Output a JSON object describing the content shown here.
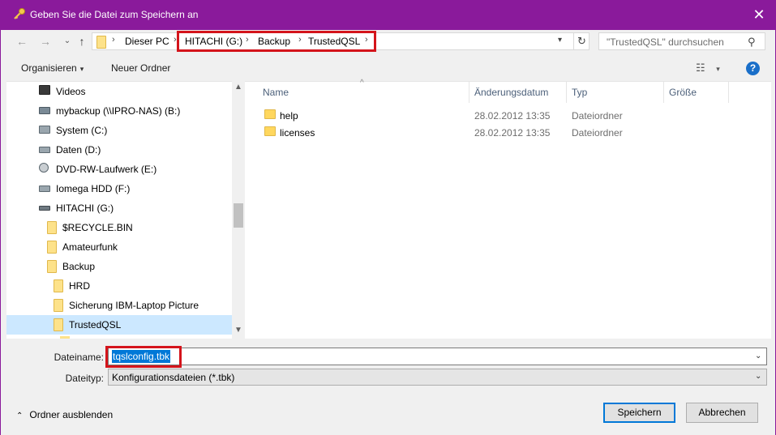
{
  "window": {
    "title": "Geben Sie die Datei zum Speichern an",
    "close_glyph": "✕"
  },
  "address": {
    "segments": [
      "Dieser PC",
      "HITACHI (G:)",
      "Backup",
      "TrustedQSL"
    ]
  },
  "search": {
    "placeholder": "\"TrustedQSL\" durchsuchen"
  },
  "toolbar": {
    "organize_label": "Organisieren",
    "new_folder_label": "Neuer Ordner",
    "help_label": "?"
  },
  "nav": {
    "items": [
      {
        "label": "Videos",
        "icon": "video-icon"
      },
      {
        "label": "mybackup (\\\\IPRO-NAS) (B:)",
        "icon": "network-drive-icon"
      },
      {
        "label": "System (C:)",
        "icon": "system-drive-icon"
      },
      {
        "label": "Daten (D:)",
        "icon": "drive-icon"
      },
      {
        "label": "DVD-RW-Laufwerk (E:)",
        "icon": "dvd-drive-icon"
      },
      {
        "label": "Iomega HDD (F:)",
        "icon": "drive-icon"
      },
      {
        "label": "HITACHI (G:)",
        "icon": "usb-drive-icon"
      },
      {
        "label": "$RECYCLE.BIN",
        "icon": "folder-icon"
      },
      {
        "label": "Amateurfunk",
        "icon": "folder-icon"
      },
      {
        "label": "Backup",
        "icon": "folder-icon"
      },
      {
        "label": "HRD",
        "icon": "folder-icon"
      },
      {
        "label": "Sicherung IBM-Laptop Picture",
        "icon": "folder-icon"
      },
      {
        "label": "TrustedQSL",
        "icon": "folder-icon"
      }
    ]
  },
  "files": {
    "columns": [
      "Name",
      "Änderungsdatum",
      "Typ",
      "Größe"
    ],
    "rows": [
      {
        "name": "help",
        "date": "28.02.2012 13:35",
        "type": "Dateiordner"
      },
      {
        "name": "licenses",
        "date": "28.02.2012 13:35",
        "type": "Dateiordner"
      }
    ]
  },
  "form": {
    "filename_label": "Dateiname:",
    "filename_value": "tqslconfig.tbk",
    "filetype_label": "Dateityp:",
    "filetype_value": "Konfigurationsdateien (*.tbk)"
  },
  "footer": {
    "hide_folders_label": "Ordner ausblenden",
    "save_label": "Speichern",
    "cancel_label": "Abbrechen"
  },
  "colors": {
    "titlebar": "#8a1a9b",
    "highlight_box": "#d4141b",
    "selection": "#0078d7",
    "nav_selected": "#cce8ff"
  }
}
